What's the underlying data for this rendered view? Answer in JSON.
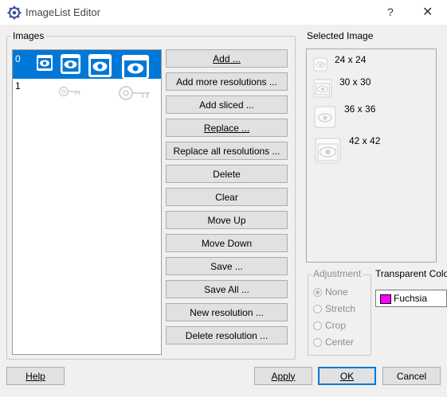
{
  "window": {
    "title": "ImageList Editor",
    "help_glyph": "?",
    "close_glyph": "✕"
  },
  "images_group": {
    "label": "Images",
    "rows": [
      {
        "index": "0",
        "selected": true,
        "icons": [
          "eye-icon-24",
          "eye-icon-30",
          "eye-icon-36",
          "eye-icon-42"
        ]
      },
      {
        "index": "1",
        "selected": false,
        "icons": [
          "key-icon",
          "key-icon"
        ]
      }
    ]
  },
  "buttons": {
    "add": "Add ...",
    "add_more": "Add more resolutions ...",
    "add_sliced": "Add sliced ...",
    "replace": "Replace ...",
    "replace_all": "Replace all resolutions ...",
    "delete": "Delete",
    "clear": "Clear",
    "move_up": "Move Up",
    "move_down": "Move Down",
    "save": "Save ...",
    "save_all": "Save All ...",
    "new_resolution": "New resolution ...",
    "delete_resolution": "Delete resolution ..."
  },
  "selected_image": {
    "label": "Selected Image",
    "sizes": [
      "24 x 24",
      "30 x 30",
      "36 x 36",
      "42 x 42"
    ]
  },
  "adjustment": {
    "label": "Adjustment",
    "options": [
      "None",
      "Stretch",
      "Crop",
      "Center"
    ],
    "selected": "None"
  },
  "transparent_color": {
    "label": "Transparent Colo",
    "value": "Fuchsia",
    "swatch": "#ff00ff"
  },
  "footer": {
    "help": "Help",
    "apply": "Apply",
    "ok": "OK",
    "cancel": "Cancel"
  },
  "colors": {
    "selection": "#0078d7",
    "accent_border": "#0078d7"
  }
}
